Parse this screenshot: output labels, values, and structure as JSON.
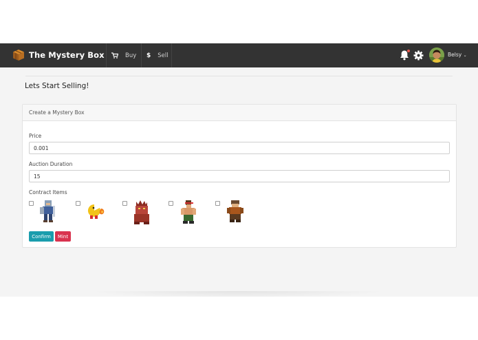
{
  "navbar": {
    "brand": "The Mystery Box",
    "items": [
      {
        "label": "Buy",
        "icon": "cart-icon"
      },
      {
        "label": "Sell",
        "icon": "dollar-icon"
      }
    ],
    "username": "Belsy",
    "notification_dot_color": "#e85a4f"
  },
  "page": {
    "title": "Lets Start Selling!"
  },
  "card": {
    "header": "Create a Mystery Box",
    "price_label": "Price",
    "price_value": "0.001",
    "duration_label": "Auction Duration",
    "duration_value": "15",
    "items_label": "Contract Items",
    "items": [
      {
        "name": "armored-knight",
        "checked": false
      },
      {
        "name": "pacman-fire",
        "checked": false
      },
      {
        "name": "red-beast",
        "checked": false
      },
      {
        "name": "commando",
        "checked": false
      },
      {
        "name": "bearded-dwarf",
        "checked": false
      }
    ],
    "confirm_label": "Confirm",
    "mint_label": "Mint"
  },
  "colors": {
    "navbar": "#333333",
    "confirm": "#1a9dad",
    "mint": "#d9334f",
    "background": "#f4f4f4"
  }
}
